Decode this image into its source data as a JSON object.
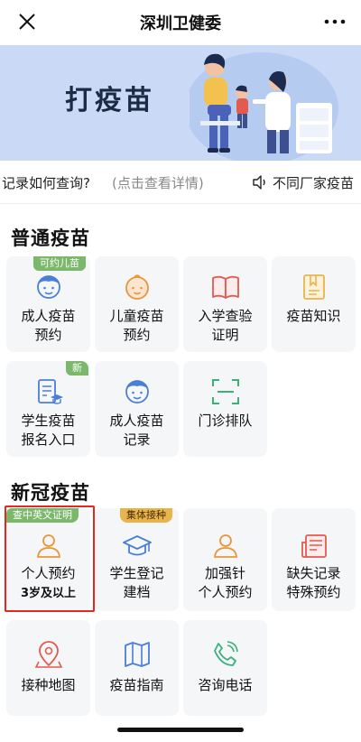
{
  "header": {
    "title": "深圳卫健委"
  },
  "banner": {
    "title": "打疫苗"
  },
  "notice": {
    "text_main": "记录如何查询?",
    "text_hint": "(点击查看详情)",
    "text_scroll": "不同厂家疫苗"
  },
  "sections": {
    "regular": {
      "title": "普通疫苗",
      "tiles": [
        {
          "line1": "成人疫苗",
          "line2": "预约",
          "badge": "可约儿苗",
          "icon": "adult-face-icon"
        },
        {
          "line1": "儿童疫苗",
          "line2": "预约",
          "icon": "baby-face-icon"
        },
        {
          "line1": "入学查验",
          "line2": "证明",
          "icon": "open-book-icon"
        },
        {
          "line1": "疫苗知识",
          "icon": "bookmark-icon"
        },
        {
          "line1": "学生疫苗",
          "line2": "报名入口",
          "badge": "新",
          "icon": "student-form-icon"
        },
        {
          "line1": "成人疫苗",
          "line2": "记录",
          "icon": "adult-face-icon"
        },
        {
          "line1": "门诊排队",
          "icon": "scan-frame-icon"
        }
      ]
    },
    "covid": {
      "title": "新冠疫苗",
      "tiles": [
        {
          "line1": "个人预约",
          "line2": "3岁及以上",
          "badge": "查中英文证明",
          "icon": "person-icon"
        },
        {
          "line1": "学生登记",
          "line2": "建档",
          "badge": "集体接种",
          "icon": "graduation-cap-icon"
        },
        {
          "line1": "加强针",
          "line2": "个人预约",
          "icon": "person-icon"
        },
        {
          "line1": "缺失记录",
          "line2": "特殊预约",
          "icon": "newspaper-icon"
        },
        {
          "line1": "接种地图",
          "icon": "map-pin-icon"
        },
        {
          "line1": "疫苗指南",
          "icon": "folded-map-icon"
        },
        {
          "line1": "咨询电话",
          "icon": "phone-icon"
        }
      ]
    }
  },
  "colors": {
    "accent_blue": "#4a7fd8",
    "orange": "#e8963a",
    "red": "#e35a4e",
    "green": "#3bb07a",
    "badge_green": "#7cb86b",
    "badge_gold": "#e8b44d",
    "highlight_red": "#e8261f"
  }
}
